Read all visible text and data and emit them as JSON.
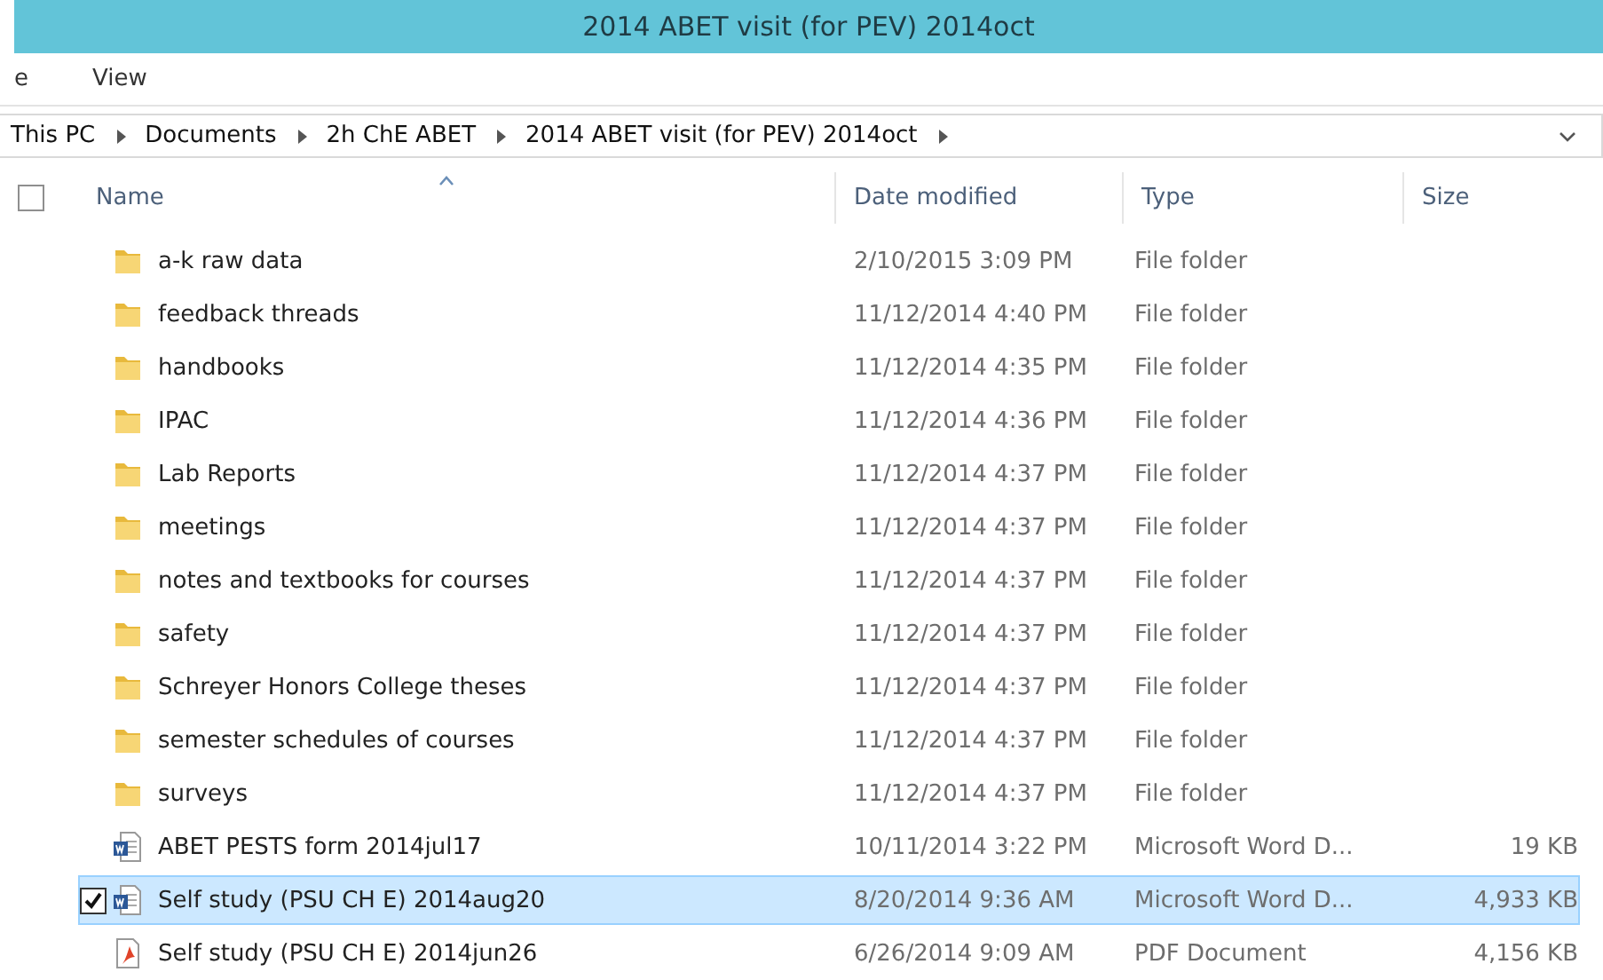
{
  "window": {
    "title": "2014 ABET visit (for PEV) 2014oct"
  },
  "menu": [
    "e",
    "View"
  ],
  "breadcrumb": [
    "This PC",
    "Documents",
    "2h ChE ABET",
    "2014 ABET visit (for PEV) 2014oct"
  ],
  "columns": [
    {
      "label": "Name",
      "sorted": true
    },
    {
      "label": "Date modified",
      "sorted": false
    },
    {
      "label": "Type",
      "sorted": false
    },
    {
      "label": "Size",
      "sorted": false
    }
  ],
  "header_checkbox": {
    "checked": false
  },
  "rows": [
    {
      "kind": "folder",
      "name": "a-k raw data",
      "date": "2/10/2015 3:09 PM",
      "type": "File folder",
      "selected": false
    },
    {
      "kind": "folder",
      "name": "feedback threads",
      "date": "11/12/2014 4:40 PM",
      "type": "File folder",
      "selected": false
    },
    {
      "kind": "folder",
      "name": "handbooks",
      "date": "11/12/2014 4:35 PM",
      "type": "File folder",
      "selected": false
    },
    {
      "kind": "folder",
      "name": "IPAC",
      "date": "11/12/2014 4:36 PM",
      "type": "File folder",
      "selected": false
    },
    {
      "kind": "folder",
      "name": "Lab Reports",
      "date": "11/12/2014 4:37 PM",
      "type": "File folder",
      "selected": false
    },
    {
      "kind": "folder",
      "name": "meetings",
      "date": "11/12/2014 4:37 PM",
      "type": "File folder",
      "selected": false
    },
    {
      "kind": "folder",
      "name": "notes and textbooks for courses",
      "date": "11/12/2014 4:37 PM",
      "type": "File folder",
      "selected": false
    },
    {
      "kind": "folder",
      "name": "safety",
      "date": "11/12/2014 4:37 PM",
      "type": "File folder",
      "selected": false
    },
    {
      "kind": "folder",
      "name": "Schreyer Honors College theses",
      "date": "11/12/2014 4:37 PM",
      "type": "File folder",
      "selected": false
    },
    {
      "kind": "folder",
      "name": "semester schedules of courses",
      "date": "11/12/2014 4:37 PM",
      "type": "File folder",
      "selected": false
    },
    {
      "kind": "folder",
      "name": "surveys",
      "date": "11/12/2014 4:37 PM",
      "type": "File folder",
      "selected": false
    },
    {
      "kind": "word",
      "name": "ABET PESTS form 2014jul17",
      "date": "10/11/2014 3:22 PM",
      "type": "Microsoft Word D...",
      "size": "19 KB",
      "selected": false
    },
    {
      "kind": "word",
      "name": "Self study (PSU CH E) 2014aug20",
      "date": "8/20/2014 9:36 AM",
      "type": "Microsoft Word D...",
      "size": "4,933 KB",
      "selected": true
    },
    {
      "kind": "pdf",
      "name": "Self study (PSU CH E) 2014jun26",
      "date": "6/26/2014 9:09 AM",
      "type": "PDF Document",
      "size": "4,156 KB",
      "selected": false
    }
  ]
}
